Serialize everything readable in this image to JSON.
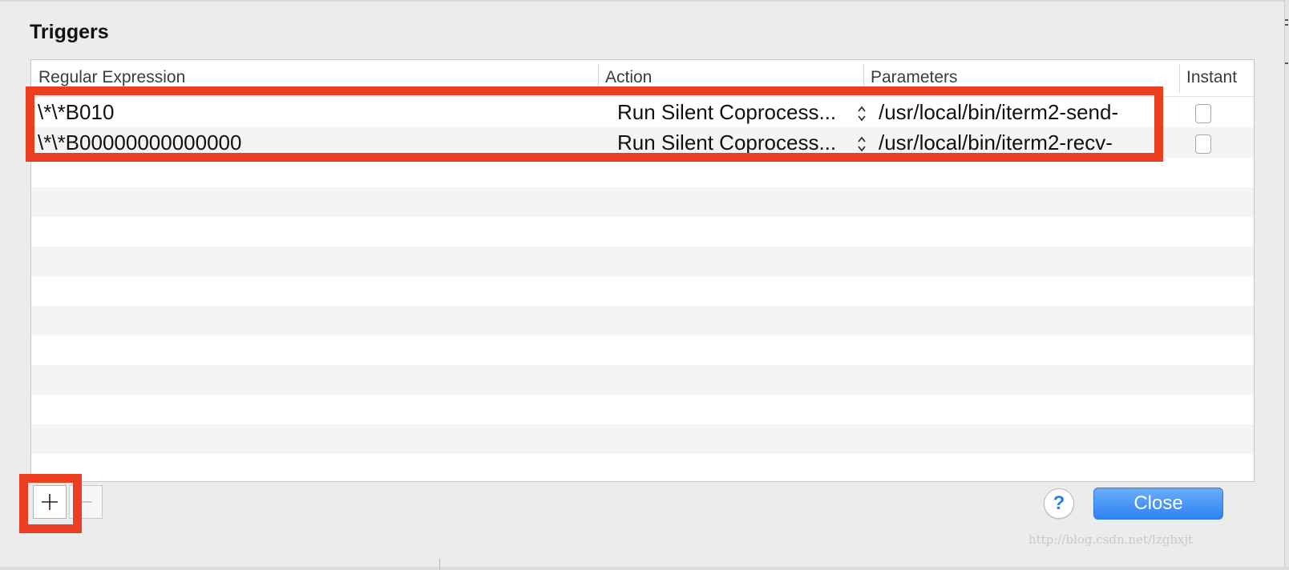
{
  "dialog": {
    "title": "Triggers"
  },
  "table": {
    "columns": {
      "regex": "Regular Expression",
      "action": "Action",
      "params": "Parameters",
      "instant": "Instant"
    },
    "rows": [
      {
        "regex": "\\*\\*B010",
        "action": "Run Silent Coprocess...",
        "params": "/usr/local/bin/iterm2-send-",
        "instant": false
      },
      {
        "regex": "\\*\\*B00000000000000",
        "action": "Run Silent Coprocess...",
        "params": "/usr/local/bin/iterm2-recv-",
        "instant": false
      }
    ]
  },
  "buttons": {
    "add_icon": "plus-icon",
    "remove_icon": "minus-icon",
    "help_label": "?",
    "close_label": "Close"
  },
  "colors": {
    "highlight": "#ec3f22",
    "accent": "#2d82f3"
  },
  "watermark": "http://blog.csdn.net/lzghxjt"
}
